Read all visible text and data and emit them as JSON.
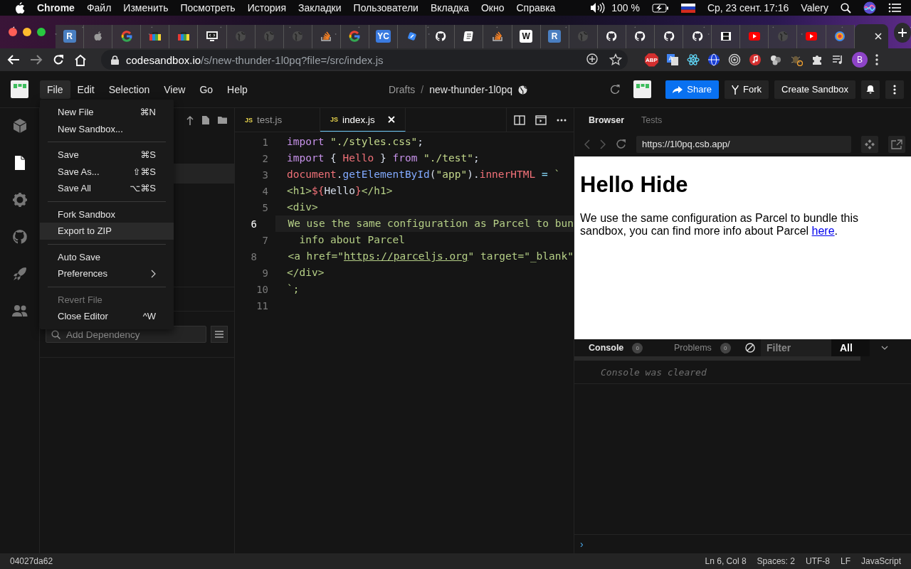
{
  "menubar": {
    "app": "Chrome",
    "items": [
      "Файл",
      "Изменить",
      "Посмотреть",
      "История",
      "Закладки",
      "Пользователи",
      "Вкладка",
      "Окно",
      "Справка"
    ],
    "battery": "100 %",
    "date": "Ср, 23 сент.",
    "time": "17:16",
    "user": "Valery"
  },
  "browser_tabs": [
    {
      "kind": "letter",
      "icon_text": "R",
      "color": "#4a7fc1",
      "selected": false
    },
    {
      "kind": "apple",
      "selected": false
    },
    {
      "kind": "google",
      "selected": false
    },
    {
      "kind": "bag",
      "selected": false
    },
    {
      "kind": "bag",
      "selected": false
    },
    {
      "kind": "monitor",
      "selected": false
    },
    {
      "kind": "globe",
      "selected": false
    },
    {
      "kind": "globe",
      "selected": false
    },
    {
      "kind": "globe",
      "selected": false
    },
    {
      "kind": "stack",
      "selected": false
    },
    {
      "kind": "google",
      "selected": false
    },
    {
      "kind": "letter",
      "icon_text": "YC",
      "color": "#3b7be0",
      "selected": false
    },
    {
      "kind": "compass",
      "selected": false
    },
    {
      "kind": "github",
      "selected": false
    },
    {
      "kind": "book",
      "selected": false
    },
    {
      "kind": "stack",
      "selected": false
    },
    {
      "kind": "letter",
      "icon_text": "W",
      "color": "#ffffff",
      "selected": false
    },
    {
      "kind": "letter",
      "icon_text": "R",
      "color": "#4a7fc1",
      "selected": false
    },
    {
      "kind": "globe",
      "selected": false
    },
    {
      "kind": "github",
      "selected": false
    },
    {
      "kind": "github",
      "selected": false
    },
    {
      "kind": "github",
      "selected": false
    },
    {
      "kind": "github",
      "selected": false
    },
    {
      "kind": "film",
      "selected": false
    },
    {
      "kind": "youtube",
      "selected": false
    },
    {
      "kind": "globe",
      "selected": false
    },
    {
      "kind": "youtube",
      "selected": false
    },
    {
      "kind": "target",
      "selected": false
    },
    {
      "kind": "blank",
      "selected": true
    }
  ],
  "address_bar": {
    "host": "codesandbox.io",
    "path": "/s/new-thunder-1l0pq?file=/src/index.js"
  },
  "extensions": [
    {
      "kind": "abp",
      "text": "ABP"
    },
    {
      "kind": "translate"
    },
    {
      "kind": "react"
    },
    {
      "kind": "globe"
    },
    {
      "kind": "rings"
    },
    {
      "kind": "music"
    },
    {
      "kind": "balls"
    },
    {
      "kind": "bug"
    },
    {
      "kind": "puzzle"
    },
    {
      "kind": "playlist"
    },
    {
      "kind": "avatar",
      "text": "B"
    }
  ],
  "header": {
    "menu": [
      {
        "label": "File",
        "selected": true
      },
      {
        "label": "Edit",
        "selected": false
      },
      {
        "label": "Selection",
        "selected": false
      },
      {
        "label": "View",
        "selected": false
      },
      {
        "label": "Go",
        "selected": false
      },
      {
        "label": "Help",
        "selected": false
      }
    ],
    "breadcrumb": {
      "folder": "Drafts",
      "separator": "/",
      "name": "new-thunder-1l0pq"
    },
    "buttons": [
      {
        "kind": "share",
        "label": "Share"
      },
      {
        "kind": "fork",
        "label": "Fork"
      },
      {
        "kind": "create",
        "label": "Create Sandbox"
      }
    ]
  },
  "activity_bar": [
    {
      "kind": "cube",
      "selected": false
    },
    {
      "kind": "file",
      "selected": true
    },
    {
      "kind": "gear",
      "selected": false
    },
    {
      "kind": "github",
      "selected": false
    },
    {
      "kind": "rocket",
      "selected": false
    },
    {
      "kind": "users",
      "selected": false
    }
  ],
  "file_menu": [
    [
      {
        "label": "New File",
        "shortcut": "⌘N",
        "disabled": false,
        "selected": false
      },
      {
        "label": "New Sandbox...",
        "disabled": false,
        "selected": false
      }
    ],
    [
      {
        "label": "Save",
        "shortcut": "⌘S",
        "disabled": false,
        "selected": false
      },
      {
        "label": "Save As...",
        "shortcut": "⇧⌘S",
        "disabled": false,
        "selected": false
      },
      {
        "label": "Save All",
        "shortcut": "⌥⌘S",
        "disabled": false,
        "selected": false
      }
    ],
    [
      {
        "label": "Fork Sandbox",
        "disabled": false,
        "selected": false
      },
      {
        "label": "Export to ZIP",
        "disabled": false,
        "selected": true
      }
    ],
    [
      {
        "label": "Auto Save",
        "disabled": false,
        "selected": false
      },
      {
        "label": "Preferences",
        "submenu": true,
        "disabled": false,
        "selected": false
      }
    ],
    [
      {
        "label": "Revert File",
        "disabled": true,
        "selected": false
      },
      {
        "label": "Close Editor",
        "shortcut": "^W",
        "disabled": false,
        "selected": false
      }
    ]
  ],
  "dependencies": {
    "placeholder": "Add Dependency"
  },
  "editor": {
    "tabs": [
      {
        "badge": "JS",
        "label": "test.js",
        "selected": false
      },
      {
        "badge": "JS",
        "label": "index.js",
        "selected": true
      }
    ],
    "lines": [
      {
        "number": "1",
        "current": false,
        "tokens": [
          {
            "kind": "keyword",
            "text": "import"
          },
          {
            "kind": "string",
            "text": " \"./styles.css\""
          },
          {
            "kind": "punct",
            "text": ";"
          }
        ]
      },
      {
        "number": "2",
        "current": false,
        "tokens": [
          {
            "kind": "keyword",
            "text": "import"
          },
          {
            "kind": "punct",
            "text": " { "
          },
          {
            "kind": "variable",
            "text": "Hello"
          },
          {
            "kind": "punct",
            "text": " } "
          },
          {
            "kind": "keyword",
            "text": "from"
          },
          {
            "kind": "string",
            "text": " \"./test\""
          },
          {
            "kind": "punct",
            "text": ";"
          }
        ]
      },
      {
        "number": "3",
        "current": false,
        "tokens": [
          {
            "kind": "variable",
            "text": "document"
          },
          {
            "kind": "punct",
            "text": "."
          },
          {
            "kind": "function",
            "text": "getElementById"
          },
          {
            "kind": "punct",
            "text": "("
          },
          {
            "kind": "string",
            "text": "\"app\""
          },
          {
            "kind": "punct",
            "text": ")."
          },
          {
            "kind": "variable",
            "text": "innerHTML"
          },
          {
            "kind": "operator",
            "text": " = "
          },
          {
            "kind": "template",
            "text": "`"
          }
        ]
      },
      {
        "number": "4",
        "current": false,
        "tokens": [
          {
            "kind": "template",
            "text": "<h1>"
          },
          {
            "kind": "variable",
            "text": "${"
          },
          {
            "kind": "plain",
            "text": "Hello"
          },
          {
            "kind": "variable",
            "text": "}"
          },
          {
            "kind": "template",
            "text": "</h1>"
          }
        ]
      },
      {
        "number": "5",
        "current": false,
        "tokens": [
          {
            "kind": "template",
            "text": "<div>"
          }
        ]
      },
      {
        "number": "6",
        "current": true,
        "tokens": [
          {
            "kind": "template",
            "text": "  We use the same configuration as Parcel to bun"
          }
        ]
      },
      {
        "number": "7",
        "current": false,
        "tokens": [
          {
            "kind": "template",
            "text": "  info about Parcel"
          }
        ]
      },
      {
        "number": "8",
        "current": false,
        "tokens": [
          {
            "kind": "template",
            "text": "  <a href=\""
          },
          {
            "kind": "link",
            "text": "https://parceljs.org"
          },
          {
            "kind": "template",
            "text": "\" target=\"_blank\""
          }
        ]
      },
      {
        "number": "9",
        "current": false,
        "tokens": [
          {
            "kind": "template",
            "text": "</div>"
          }
        ]
      },
      {
        "number": "10",
        "current": false,
        "tokens": [
          {
            "kind": "template",
            "text": "`;"
          }
        ]
      },
      {
        "number": "11",
        "current": false
      }
    ]
  },
  "preview": {
    "tabs": [
      {
        "label": "Browser",
        "selected": true
      },
      {
        "label": "Tests",
        "selected": false
      }
    ],
    "url": "https://1l0pq.csb.app/",
    "heading": "Hello Hide",
    "paragraph": "We use the same configuration as Parcel to bundle this sandbox, you can find more info about Parcel",
    "link": "here",
    "after_link": ".",
    "console_tabs": [
      {
        "label": "Console",
        "count": "0",
        "selected": true
      },
      {
        "label": "Problems",
        "count": "0",
        "selected": false
      }
    ],
    "filter": {
      "placeholder": "Filter"
    },
    "level": "All",
    "message": "Console was cleared",
    "prompt": "›"
  },
  "status_bar": {
    "commit": "04027da62",
    "items": [
      "Ln 6, Col 8",
      "Spaces: 2",
      "UTF-8",
      "LF",
      "JavaScript"
    ]
  }
}
